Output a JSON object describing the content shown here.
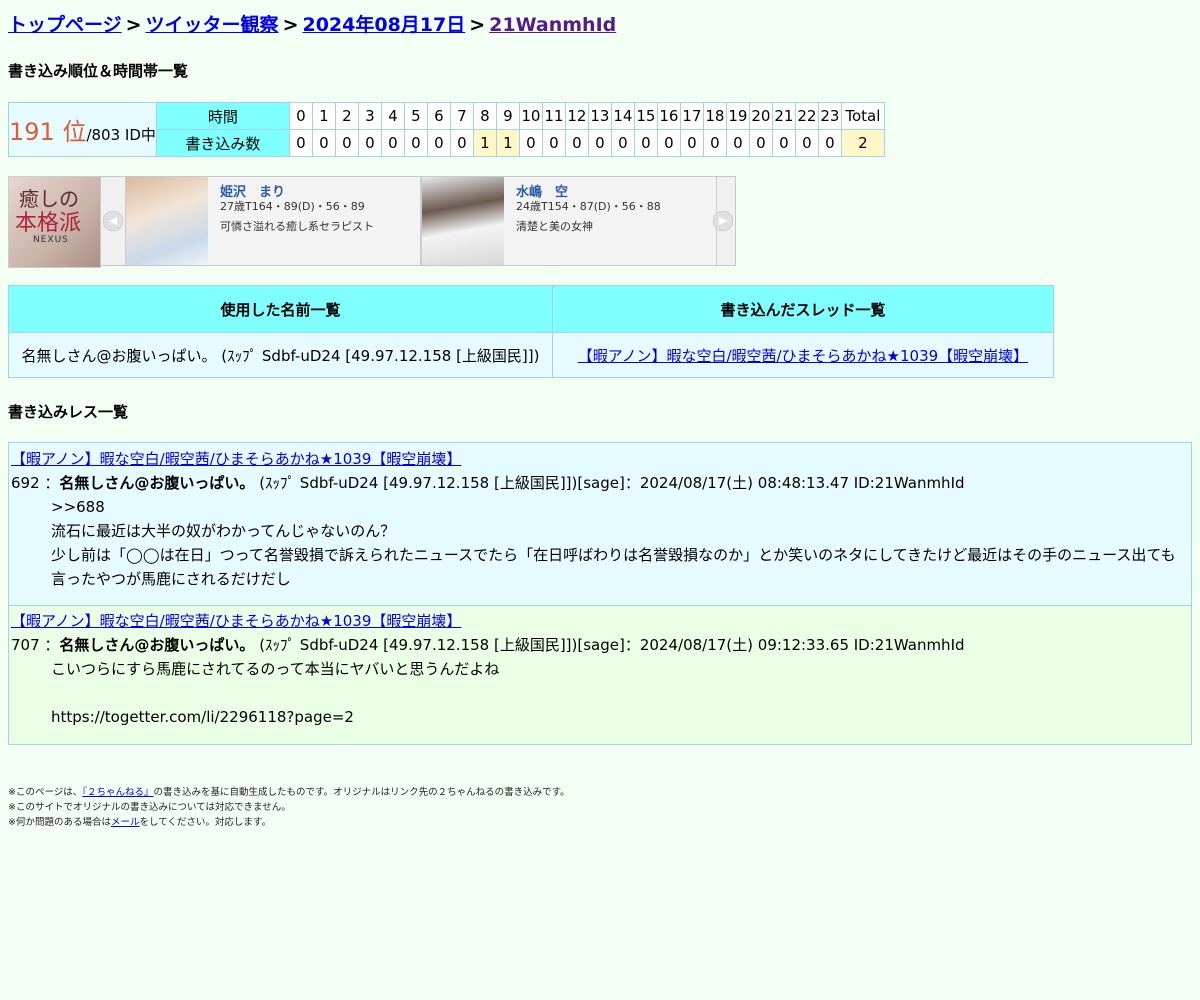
{
  "breadcrumb": {
    "top": "トップページ",
    "category": "ツイッター観察",
    "date": "2024年08月17日",
    "id": "21WanmhId",
    "sep": ">"
  },
  "ranking": {
    "title": "書き込み順位＆時間帯一覧",
    "rank": "191 位",
    "of": "/803 ID中",
    "time_label": "時間",
    "count_label": "書き込み数",
    "hours": [
      "0",
      "1",
      "2",
      "3",
      "4",
      "5",
      "6",
      "7",
      "8",
      "9",
      "10",
      "11",
      "12",
      "13",
      "14",
      "15",
      "16",
      "17",
      "18",
      "19",
      "20",
      "21",
      "22",
      "23",
      "Total"
    ],
    "counts": [
      "0",
      "0",
      "0",
      "0",
      "0",
      "0",
      "0",
      "0",
      "1",
      "1",
      "0",
      "0",
      "0",
      "0",
      "0",
      "0",
      "0",
      "0",
      "0",
      "0",
      "0",
      "0",
      "0",
      "0",
      "2"
    ]
  },
  "ad": {
    "logo_line1": "癒しの",
    "logo_line2": "本格派",
    "logo_line3": "NEXUS",
    "cards": [
      {
        "name": "姫沢　まり",
        "spec": "27歳T164・89(D)・56・89",
        "catch": "可憐さ溢れる癒し系セラピスト"
      },
      {
        "name": "水嶋　空",
        "spec": "24歳T154・87(D)・56・88",
        "catch": "清楚と美の女神"
      }
    ]
  },
  "names_threads": {
    "names_header": "使用した名前一覧",
    "threads_header": "書き込んだスレッド一覧",
    "name": "名無しさん@お腹いっぱい。 (ｽｯﾌﾟ Sdbf-uD24 [49.97.12.158 [上級国民]])",
    "thread": "【暇アノン】暇な空白/暇空茜/ひまそらあかね★1039【暇空崩壊】"
  },
  "posts_title": "書き込みレス一覧",
  "posts": [
    {
      "thread": "【暇アノン】暇な空白/暇空茜/ひまそらあかね★1039【暇空崩壊】",
      "num": "692 ：",
      "name": "名無しさん@お腹いっぱい。",
      "info": " (ｽｯﾌﾟ Sdbf-uD24 [49.97.12.158 [上級国民]])[sage]：2024/08/17(土) 08:48:13.47 ID:21WanmhId",
      "lines": [
        ">>688",
        "流石に最近は大半の奴がわかってんじゃないのん？",
        "少し前は「◯◯は在日」つって名誉毀損で訴えられたニュースでたら「在日呼ばわりは名誉毀損なのか」とか笑いのネタにしてきたけど最近はその手のニュース出ても言ったやつが馬鹿にされるだけだし"
      ]
    },
    {
      "thread": "【暇アノン】暇な空白/暇空茜/ひまそらあかね★1039【暇空崩壊】",
      "num": "707 ：",
      "name": "名無しさん@お腹いっぱい。",
      "info": " (ｽｯﾌﾟ Sdbf-uD24 [49.97.12.158 [上級国民]])[sage]：2024/08/17(土) 09:12:33.65 ID:21WanmhId",
      "lines": [
        "こいつらにすら馬鹿にされてるのって本当にヤバいと思うんだよね",
        "",
        "https://togetter.com/li/2296118?page=2"
      ]
    }
  ],
  "footer": {
    "line1_pre": "※このページは、",
    "line1_link": "『２ちゃんねる』",
    "line1_post": "の書き込みを基に自動生成したものです。オリジナルはリンク先の２ちゃんねるの書き込みです。",
    "line2": "※このサイトでオリジナルの書き込みについては対応できません。",
    "line3_pre": "※何か問題のある場合は",
    "line3_link": "メール",
    "line3_post": "をしてください。対応します。"
  }
}
